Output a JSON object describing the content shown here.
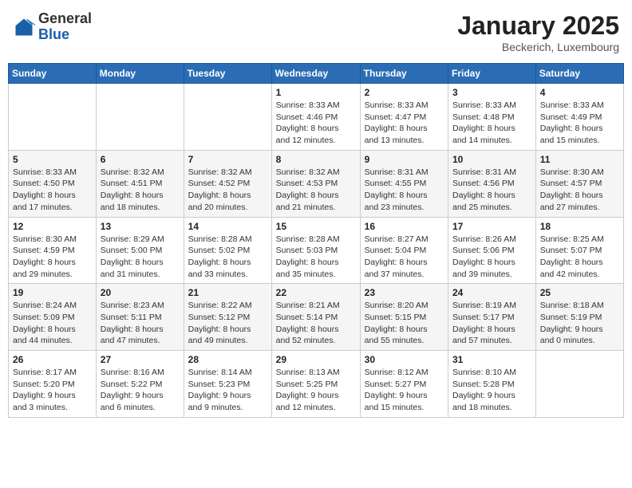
{
  "logo": {
    "general": "General",
    "blue": "Blue"
  },
  "header": {
    "month": "January 2025",
    "location": "Beckerich, Luxembourg"
  },
  "weekdays": [
    "Sunday",
    "Monday",
    "Tuesday",
    "Wednesday",
    "Thursday",
    "Friday",
    "Saturday"
  ],
  "weeks": [
    [
      {
        "day": "",
        "info": ""
      },
      {
        "day": "",
        "info": ""
      },
      {
        "day": "",
        "info": ""
      },
      {
        "day": "1",
        "info": "Sunrise: 8:33 AM\nSunset: 4:46 PM\nDaylight: 8 hours\nand 12 minutes."
      },
      {
        "day": "2",
        "info": "Sunrise: 8:33 AM\nSunset: 4:47 PM\nDaylight: 8 hours\nand 13 minutes."
      },
      {
        "day": "3",
        "info": "Sunrise: 8:33 AM\nSunset: 4:48 PM\nDaylight: 8 hours\nand 14 minutes."
      },
      {
        "day": "4",
        "info": "Sunrise: 8:33 AM\nSunset: 4:49 PM\nDaylight: 8 hours\nand 15 minutes."
      }
    ],
    [
      {
        "day": "5",
        "info": "Sunrise: 8:33 AM\nSunset: 4:50 PM\nDaylight: 8 hours\nand 17 minutes."
      },
      {
        "day": "6",
        "info": "Sunrise: 8:32 AM\nSunset: 4:51 PM\nDaylight: 8 hours\nand 18 minutes."
      },
      {
        "day": "7",
        "info": "Sunrise: 8:32 AM\nSunset: 4:52 PM\nDaylight: 8 hours\nand 20 minutes."
      },
      {
        "day": "8",
        "info": "Sunrise: 8:32 AM\nSunset: 4:53 PM\nDaylight: 8 hours\nand 21 minutes."
      },
      {
        "day": "9",
        "info": "Sunrise: 8:31 AM\nSunset: 4:55 PM\nDaylight: 8 hours\nand 23 minutes."
      },
      {
        "day": "10",
        "info": "Sunrise: 8:31 AM\nSunset: 4:56 PM\nDaylight: 8 hours\nand 25 minutes."
      },
      {
        "day": "11",
        "info": "Sunrise: 8:30 AM\nSunset: 4:57 PM\nDaylight: 8 hours\nand 27 minutes."
      }
    ],
    [
      {
        "day": "12",
        "info": "Sunrise: 8:30 AM\nSunset: 4:59 PM\nDaylight: 8 hours\nand 29 minutes."
      },
      {
        "day": "13",
        "info": "Sunrise: 8:29 AM\nSunset: 5:00 PM\nDaylight: 8 hours\nand 31 minutes."
      },
      {
        "day": "14",
        "info": "Sunrise: 8:28 AM\nSunset: 5:02 PM\nDaylight: 8 hours\nand 33 minutes."
      },
      {
        "day": "15",
        "info": "Sunrise: 8:28 AM\nSunset: 5:03 PM\nDaylight: 8 hours\nand 35 minutes."
      },
      {
        "day": "16",
        "info": "Sunrise: 8:27 AM\nSunset: 5:04 PM\nDaylight: 8 hours\nand 37 minutes."
      },
      {
        "day": "17",
        "info": "Sunrise: 8:26 AM\nSunset: 5:06 PM\nDaylight: 8 hours\nand 39 minutes."
      },
      {
        "day": "18",
        "info": "Sunrise: 8:25 AM\nSunset: 5:07 PM\nDaylight: 8 hours\nand 42 minutes."
      }
    ],
    [
      {
        "day": "19",
        "info": "Sunrise: 8:24 AM\nSunset: 5:09 PM\nDaylight: 8 hours\nand 44 minutes."
      },
      {
        "day": "20",
        "info": "Sunrise: 8:23 AM\nSunset: 5:11 PM\nDaylight: 8 hours\nand 47 minutes."
      },
      {
        "day": "21",
        "info": "Sunrise: 8:22 AM\nSunset: 5:12 PM\nDaylight: 8 hours\nand 49 minutes."
      },
      {
        "day": "22",
        "info": "Sunrise: 8:21 AM\nSunset: 5:14 PM\nDaylight: 8 hours\nand 52 minutes."
      },
      {
        "day": "23",
        "info": "Sunrise: 8:20 AM\nSunset: 5:15 PM\nDaylight: 8 hours\nand 55 minutes."
      },
      {
        "day": "24",
        "info": "Sunrise: 8:19 AM\nSunset: 5:17 PM\nDaylight: 8 hours\nand 57 minutes."
      },
      {
        "day": "25",
        "info": "Sunrise: 8:18 AM\nSunset: 5:19 PM\nDaylight: 9 hours\nand 0 minutes."
      }
    ],
    [
      {
        "day": "26",
        "info": "Sunrise: 8:17 AM\nSunset: 5:20 PM\nDaylight: 9 hours\nand 3 minutes."
      },
      {
        "day": "27",
        "info": "Sunrise: 8:16 AM\nSunset: 5:22 PM\nDaylight: 9 hours\nand 6 minutes."
      },
      {
        "day": "28",
        "info": "Sunrise: 8:14 AM\nSunset: 5:23 PM\nDaylight: 9 hours\nand 9 minutes."
      },
      {
        "day": "29",
        "info": "Sunrise: 8:13 AM\nSunset: 5:25 PM\nDaylight: 9 hours\nand 12 minutes."
      },
      {
        "day": "30",
        "info": "Sunrise: 8:12 AM\nSunset: 5:27 PM\nDaylight: 9 hours\nand 15 minutes."
      },
      {
        "day": "31",
        "info": "Sunrise: 8:10 AM\nSunset: 5:28 PM\nDaylight: 9 hours\nand 18 minutes."
      },
      {
        "day": "",
        "info": ""
      }
    ]
  ]
}
